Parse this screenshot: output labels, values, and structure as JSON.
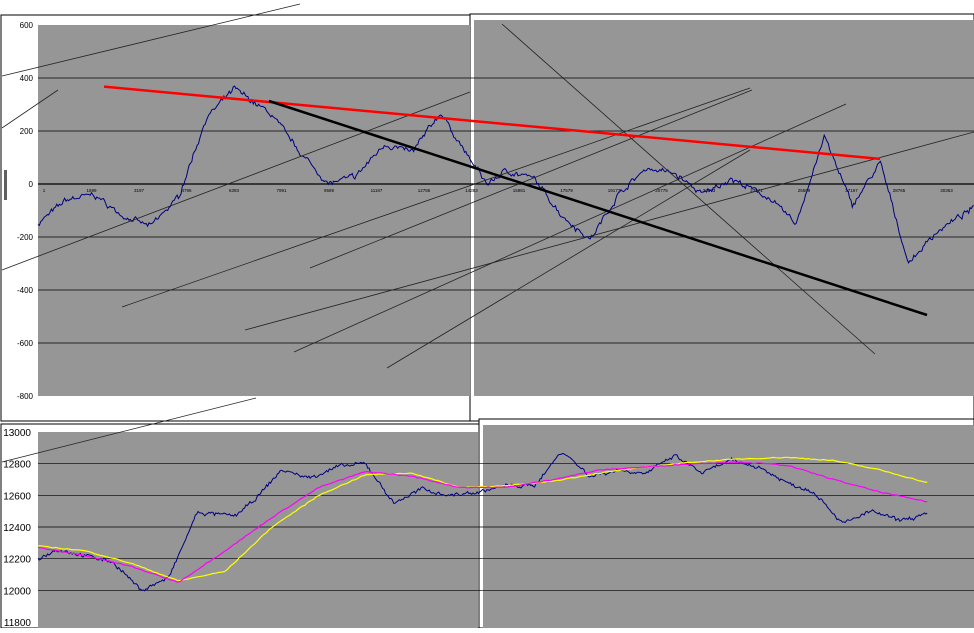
{
  "colors": {
    "plot_bg": "#969696",
    "window_bg": "#ffffff",
    "price": "#000080",
    "trendline_red": "#ff0000",
    "trendline_black": "#000000",
    "ma_fast": "#ff00ff",
    "ma_slow": "#ffff00",
    "gridline": "#000000"
  },
  "chart_data": [
    {
      "type": "line",
      "ylim": [
        -800,
        600
      ],
      "yticks": [
        "600",
        "400",
        "200",
        "0",
        "-200",
        "-400",
        "-600",
        "-800"
      ],
      "x_tick_labels": [
        "1",
        "1599",
        "3197",
        "4795",
        "6393",
        "7991",
        "9589",
        "11187",
        "12785",
        "14383",
        "15981",
        "17579",
        "19177",
        "20775",
        "22373",
        "23971",
        "25569",
        "27167",
        "28765",
        "30363"
      ],
      "grid": "horizontal",
      "series": [
        {
          "role": "price_deviation",
          "x": [
            0,
            3,
            6,
            9,
            12,
            15,
            18,
            21,
            25,
            28,
            31,
            34,
            37,
            40,
            43,
            46,
            48,
            50,
            53,
            56,
            59,
            62,
            65,
            68,
            71,
            74,
            78,
            81,
            84,
            87,
            90,
            93,
            96,
            100
          ],
          "y": [
            -150,
            -60,
            -40,
            -120,
            -160,
            -50,
            250,
            360,
            260,
            120,
            0,
            30,
            150,
            120,
            270,
            100,
            0,
            50,
            20,
            -120,
            -210,
            -40,
            60,
            40,
            -40,
            20,
            -50,
            -150,
            180,
            -80,
            80,
            -300,
            -180,
            -90
          ]
        },
        {
          "role": "trendline",
          "x": [
            0,
            100
          ],
          "y": [
            390,
            95
          ]
        },
        {
          "role": "trendline",
          "x": [
            20,
            95
          ],
          "y": [
            310,
            -490
          ]
        }
      ]
    },
    {
      "type": "line",
      "ylim": [
        11800,
        13000
      ],
      "yticks": [
        "13000",
        "12800",
        "12600",
        "12400",
        "12200",
        "12000",
        "11800"
      ],
      "grid": "horizontal",
      "series": [
        {
          "role": "price",
          "x": [
            0,
            2,
            5,
            8,
            11,
            14,
            17,
            19,
            21,
            23,
            26,
            29,
            32,
            35,
            38,
            41,
            44,
            47,
            50,
            53,
            56,
            59,
            62,
            65,
            68,
            71,
            74,
            77,
            80,
            83,
            86,
            89,
            92,
            95
          ],
          "y": [
            12200,
            12260,
            12220,
            12180,
            12000,
            12080,
            12490,
            12480,
            12470,
            12560,
            12760,
            12710,
            12780,
            12800,
            12550,
            12640,
            12600,
            12620,
            12660,
            12660,
            12880,
            12720,
            12760,
            12740,
            12850,
            12740,
            12820,
            12780,
            12680,
            12620,
            12420,
            12500,
            12440,
            12480
          ]
        },
        {
          "role": "moving_average_fast",
          "x": [
            0,
            5,
            10,
            15,
            20,
            25,
            30,
            35,
            40,
            45,
            50,
            55,
            60,
            65,
            70,
            75,
            80,
            85,
            90,
            95
          ],
          "y": [
            12270,
            12220,
            12150,
            12050,
            12250,
            12460,
            12650,
            12750,
            12720,
            12650,
            12650,
            12700,
            12760,
            12780,
            12800,
            12810,
            12790,
            12700,
            12620,
            12560
          ]
        },
        {
          "role": "moving_average_slow",
          "x": [
            0,
            5,
            10,
            15,
            20,
            25,
            30,
            35,
            40,
            45,
            50,
            55,
            60,
            65,
            70,
            75,
            80,
            85,
            90,
            95
          ],
          "y": [
            12280,
            12250,
            12170,
            12060,
            12120,
            12400,
            12600,
            12730,
            12740,
            12650,
            12660,
            12690,
            12740,
            12780,
            12810,
            12830,
            12840,
            12820,
            12760,
            12680
          ]
        }
      ]
    }
  ]
}
